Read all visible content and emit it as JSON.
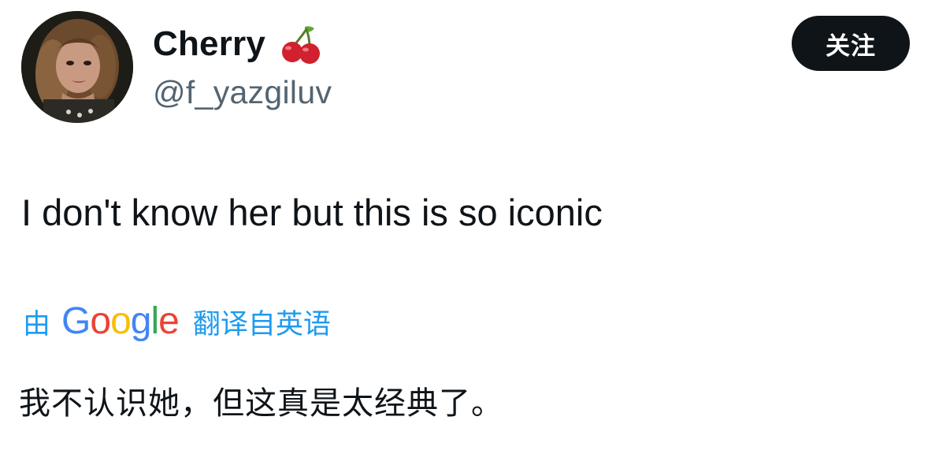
{
  "tweet": {
    "author": {
      "display_name": "Cherry",
      "name_emoji": "cherry-emoji",
      "handle": "@f_yazgiluv"
    },
    "follow_button_label": "关注",
    "text": "I don't know her but this is so iconic",
    "translation": {
      "prefix": "由",
      "provider": "Google",
      "suffix": "翻译自英语",
      "translated_text": "我不认识她，但这真是太经典了。"
    }
  },
  "colors": {
    "primary_text": "#0f1419",
    "secondary_text": "#536471",
    "link": "#1d9bf0",
    "button_bg": "#0f1419",
    "button_text": "#ffffff",
    "google_blue": "#4285f4",
    "google_red": "#ea4335",
    "google_yellow": "#fbbc05",
    "google_green": "#34a853"
  }
}
